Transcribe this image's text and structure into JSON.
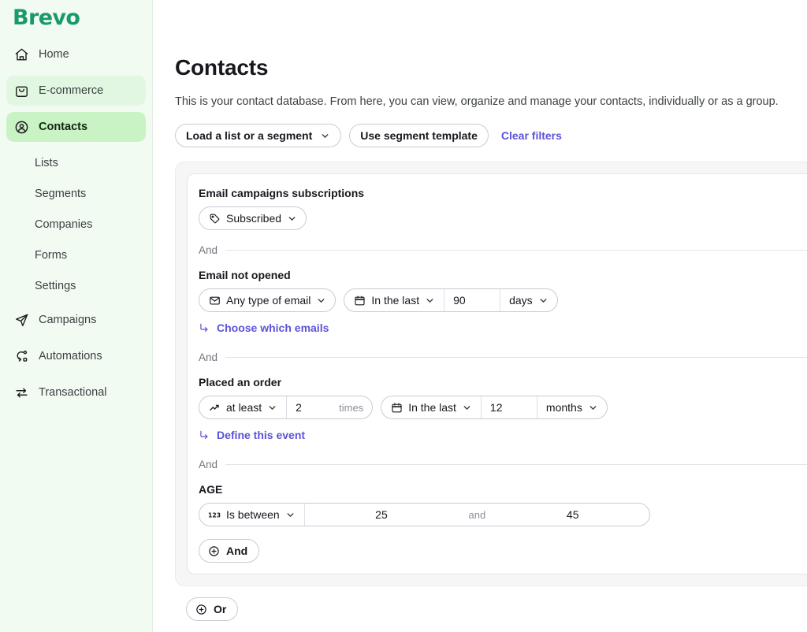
{
  "brand": {
    "name": "Brevo"
  },
  "sidebar": {
    "items": [
      {
        "label": "Home",
        "icon": "home-icon",
        "state": "default"
      },
      {
        "label": "E-commerce",
        "icon": "shopping-bag-icon",
        "state": "shaded"
      },
      {
        "label": "Contacts",
        "icon": "contact-circle-icon",
        "state": "active"
      }
    ],
    "sub_items": [
      {
        "label": "Lists"
      },
      {
        "label": "Segments"
      },
      {
        "label": "Companies"
      },
      {
        "label": "Forms"
      },
      {
        "label": "Settings"
      }
    ],
    "items_bottom": [
      {
        "label": "Campaigns",
        "icon": "paper-plane-icon"
      },
      {
        "label": "Automations",
        "icon": "automation-nodes-icon"
      },
      {
        "label": "Transactional",
        "icon": "exchange-arrows-icon"
      }
    ]
  },
  "page": {
    "title": "Contacts",
    "description": "This is your contact database. From here, you can view, organize and manage your contacts, individually or as a group."
  },
  "toolbar": {
    "load_list_label": "Load a list or a segment",
    "use_template_label": "Use segment template",
    "clear_filters_label": "Clear filters"
  },
  "filters": {
    "subscription": {
      "label": "Email campaigns subscriptions",
      "value": "Subscribed",
      "icon": "tag-icon"
    },
    "divider_1": "And",
    "email_not_opened": {
      "label": "Email not opened",
      "email_type": "Any type of email",
      "email_type_icon": "envelope-icon",
      "period_label": "In the last",
      "period_icon": "calendar-icon",
      "period_value": "90",
      "period_unit": "days",
      "sub_link": "Choose which emails"
    },
    "divider_2": "And",
    "placed_an_order": {
      "label": "Placed an order",
      "operator": "at least",
      "operator_icon": "trend-up-icon",
      "count_value": "2",
      "count_unit": "times",
      "period_label": "In the last",
      "period_icon": "calendar-icon",
      "period_value": "12",
      "period_unit": "months",
      "sub_link": "Define this event"
    },
    "divider_3": "And",
    "age": {
      "label": "AGE",
      "operator": "Is between",
      "operator_icon": "numeric-123-icon",
      "min_value": "25",
      "separator": "and",
      "max_value": "45"
    },
    "add_and_label": "And",
    "add_or_label": "Or"
  },
  "colors": {
    "brand_green": "#1a9a6c",
    "sidebar_bg": "#f2fbf2",
    "active_item_bg": "#c9f3c4",
    "active_indicator": "#1d8a63",
    "link_purple": "#5b52d9",
    "panel_bg": "#f6f6f7"
  }
}
